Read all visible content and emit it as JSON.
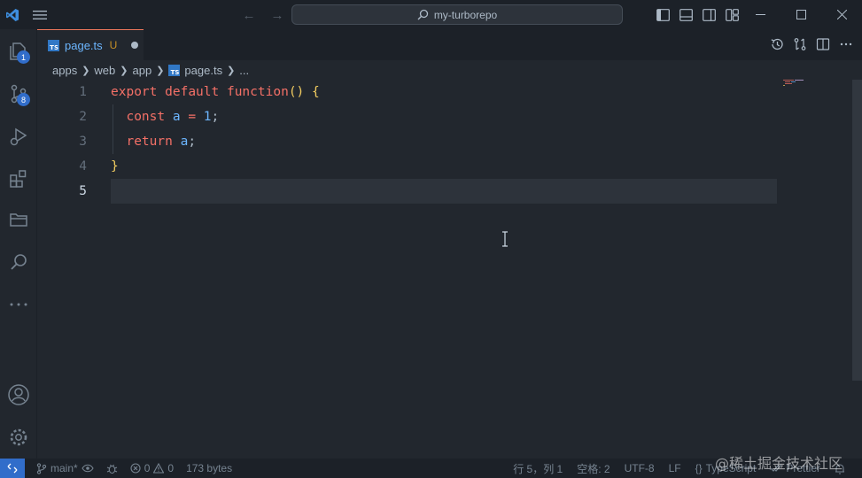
{
  "window": {
    "search_text": "my-turborepo"
  },
  "activity": {
    "explorer_badge": "1",
    "scm_badge": "8"
  },
  "tab": {
    "name": "page.ts",
    "status": "U",
    "icon_text": "TS"
  },
  "breadcrumb": [
    "apps",
    "web",
    "app",
    "page.ts",
    "..."
  ],
  "editor": {
    "line_numbers": [
      "1",
      "2",
      "3",
      "4",
      "5"
    ],
    "line1": {
      "export": "export",
      "default": "default",
      "function": "function",
      "parens": "()",
      "brace": "{"
    },
    "line2": {
      "const": "const",
      "name": "a",
      "eq": "=",
      "value": "1",
      "semi": ";"
    },
    "line3": {
      "return": "return",
      "name": "a",
      "semi": ";"
    },
    "line4": {
      "brace": "}"
    }
  },
  "statusbar": {
    "branch": "main*",
    "errors": "0",
    "warnings": "0",
    "size": "173 bytes",
    "position": "行 5，列 1",
    "indent": "空格: 2",
    "encoding": "UTF-8",
    "eol": "LF",
    "language_braces": "{}",
    "language": "TypeScript",
    "formatter": "Prettier"
  },
  "watermark": "@稀土掘金技术社区"
}
